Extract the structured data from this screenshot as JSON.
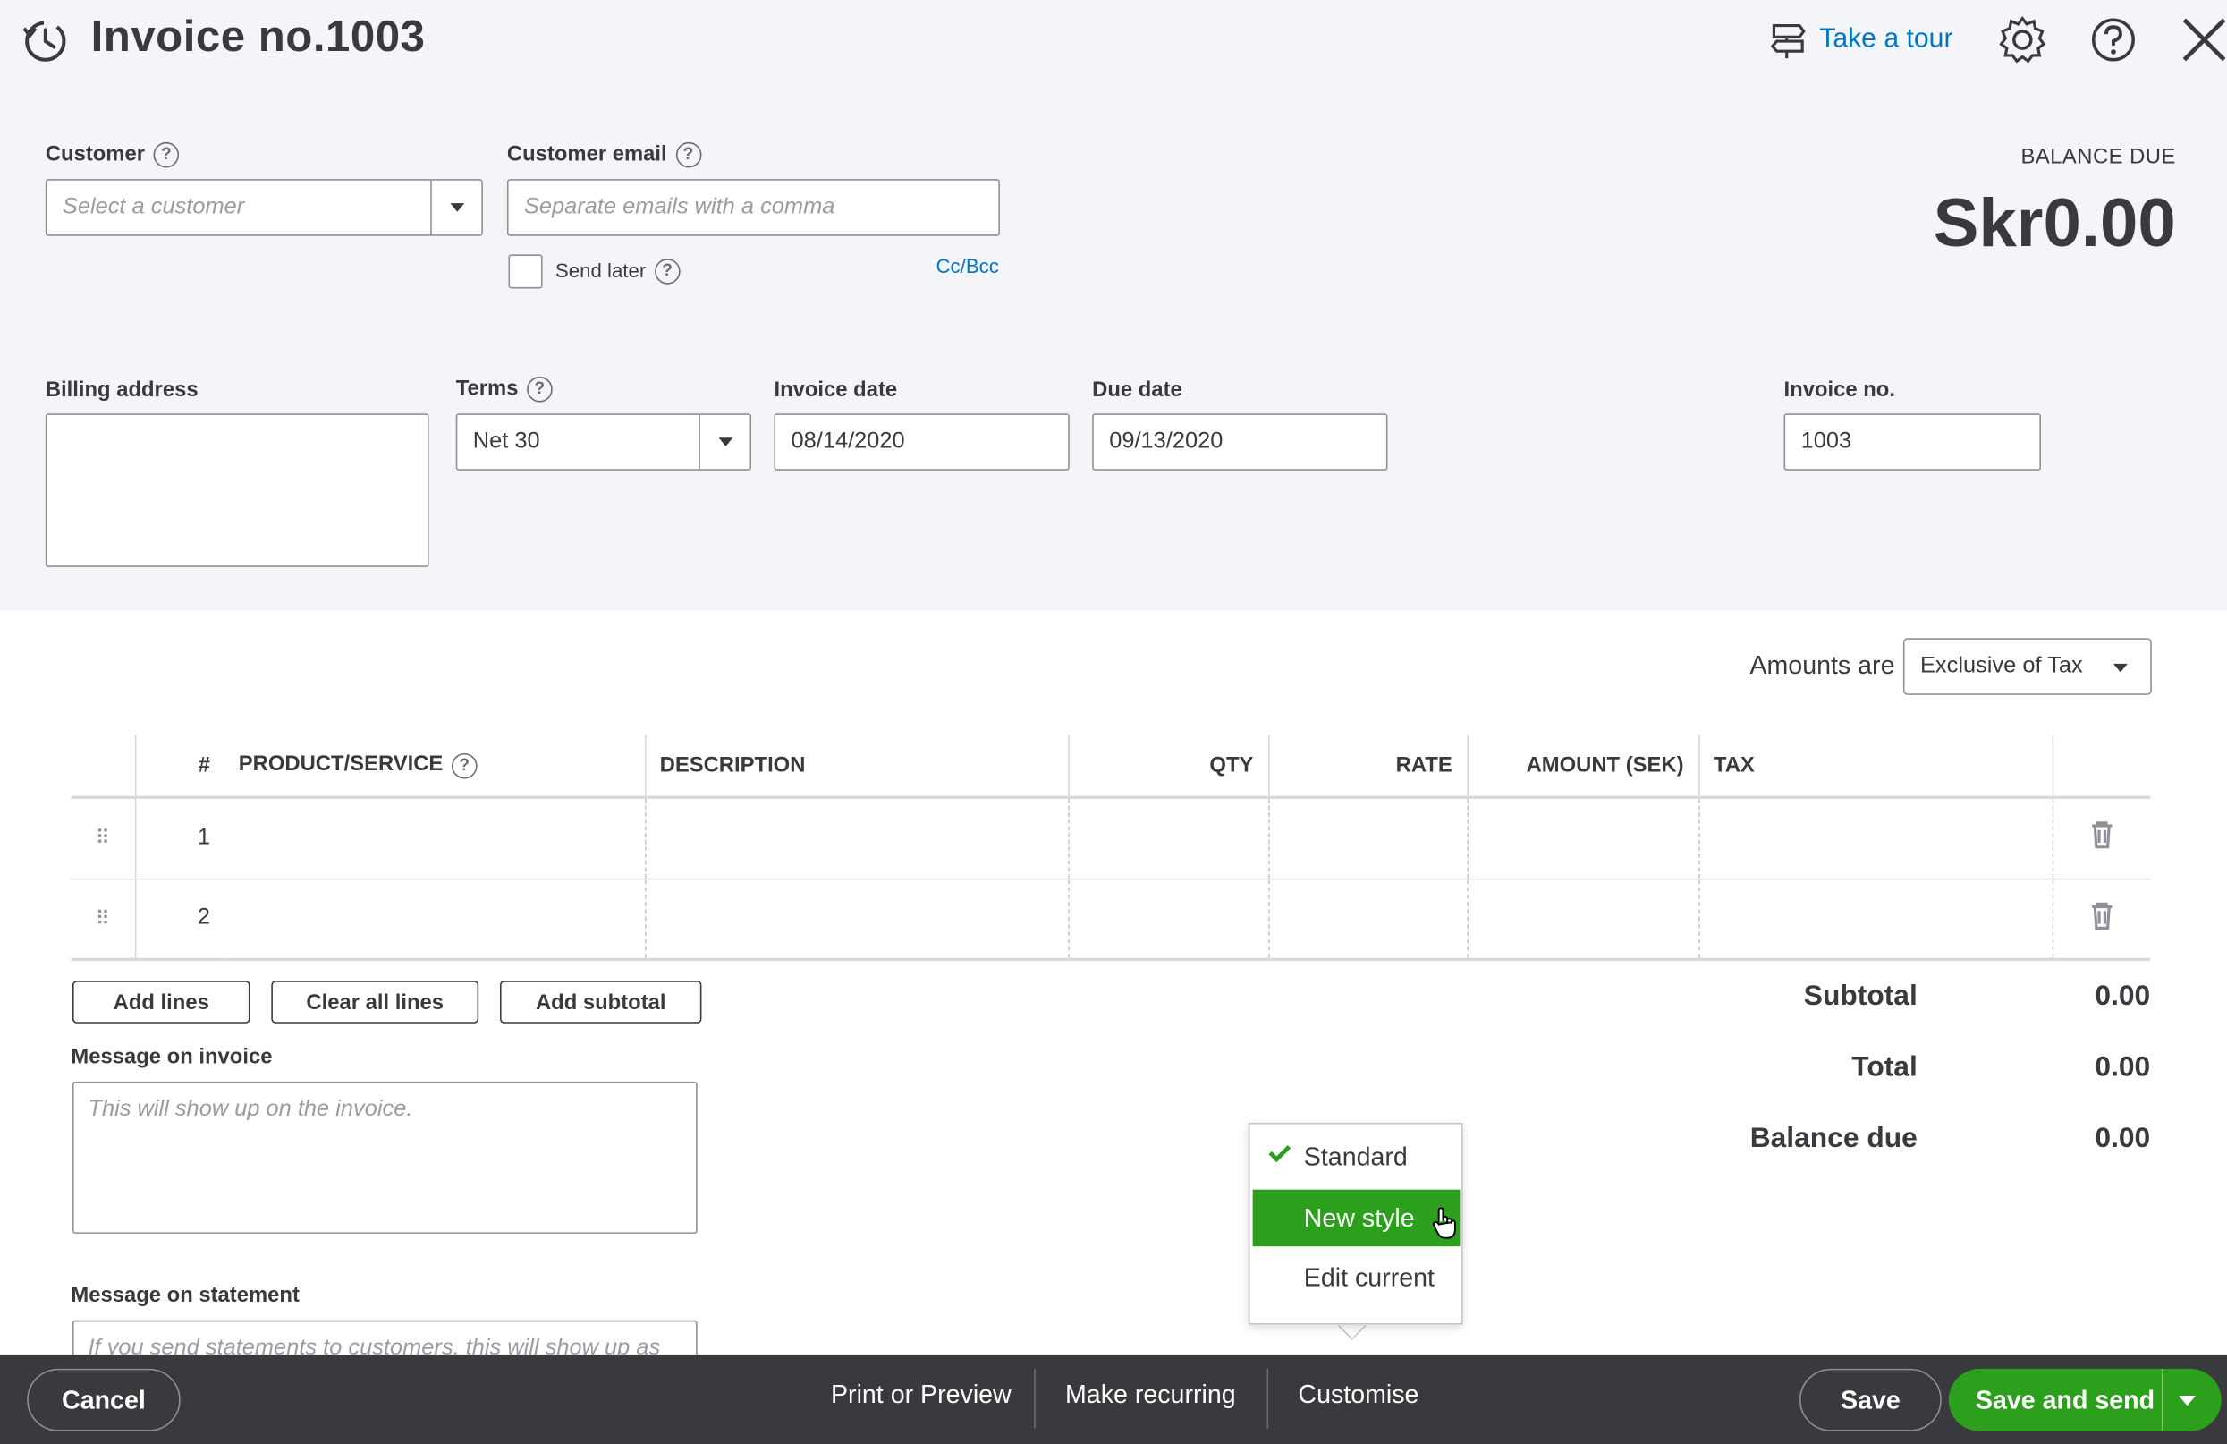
{
  "header": {
    "title": "Invoice no.1003",
    "take_tour": "Take a tour",
    "icons": [
      "history-icon",
      "signpost-icon",
      "gear-icon",
      "help-icon",
      "close-icon"
    ]
  },
  "customer": {
    "label": "Customer",
    "placeholder": "Select a customer"
  },
  "email": {
    "label": "Customer email",
    "placeholder": "Separate emails with a comma",
    "send_later": "Send later",
    "cc_bcc": "Cc/Bcc"
  },
  "balance": {
    "label": "BALANCE DUE",
    "amount": "Skr0.00"
  },
  "billing": {
    "label": "Billing address"
  },
  "terms": {
    "label": "Terms",
    "value": "Net 30"
  },
  "invoice_date": {
    "label": "Invoice date",
    "value": "08/14/2020"
  },
  "due_date": {
    "label": "Due date",
    "value": "09/13/2020"
  },
  "invoice_no": {
    "label": "Invoice no.",
    "value": "1003"
  },
  "amounts": {
    "label": "Amounts are",
    "value": "Exclusive of Tax"
  },
  "table": {
    "headers": {
      "num": "#",
      "product": "PRODUCT/SERVICE",
      "description": "DESCRIPTION",
      "qty": "QTY",
      "rate": "RATE",
      "amount": "AMOUNT (SEK)",
      "tax": "TAX"
    },
    "rows": [
      {
        "num": "1"
      },
      {
        "num": "2"
      }
    ]
  },
  "actions": {
    "add_lines": "Add lines",
    "clear_all": "Clear all lines",
    "add_subtotal": "Add subtotal"
  },
  "message_invoice": {
    "label": "Message on invoice",
    "placeholder": "This will show up on the invoice."
  },
  "message_statement": {
    "label": "Message on statement",
    "placeholder": "If you send statements to customers, this will show up as"
  },
  "totals": {
    "subtotal_label": "Subtotal",
    "subtotal": "0.00",
    "total_label": "Total",
    "total": "0.00",
    "balance_label": "Balance due",
    "balance": "0.00"
  },
  "customise_menu": {
    "items": [
      "Standard",
      "New style",
      "Edit current"
    ],
    "checked": "Standard",
    "highlighted": "New style"
  },
  "footer": {
    "cancel": "Cancel",
    "print": "Print or Preview",
    "recurring": "Make recurring",
    "customise": "Customise",
    "save": "Save",
    "save_send": "Save and send"
  },
  "colors": {
    "accent_green": "#2ca01c",
    "link_blue": "#0077c5",
    "footer_bg": "#393a3d"
  }
}
